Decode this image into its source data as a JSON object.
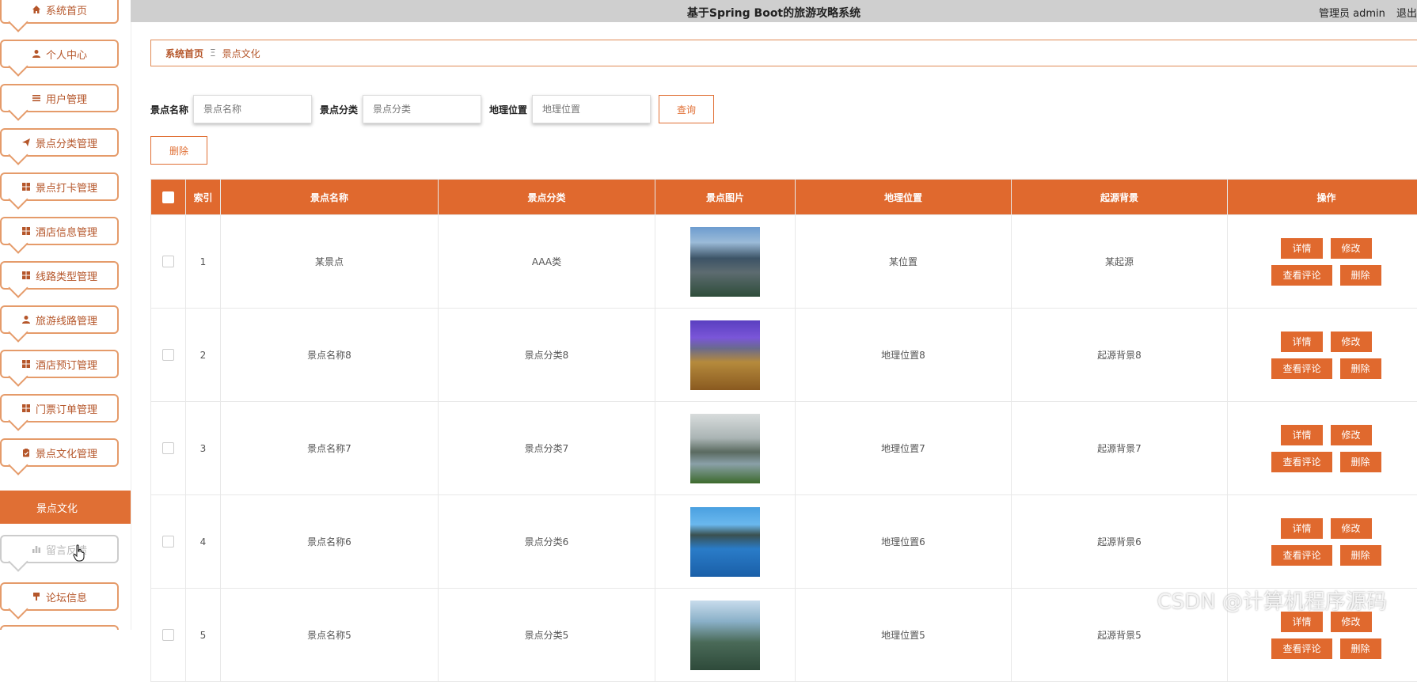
{
  "header": {
    "title": "基于Spring Boot的旅游攻略系统",
    "user": "管理员 admin",
    "logout": "退出"
  },
  "sidebar": {
    "items": [
      {
        "label": "系统首页",
        "icon": "home-icon"
      },
      {
        "label": "个人中心",
        "icon": "user-icon"
      },
      {
        "label": "用户管理",
        "icon": "list-icon"
      },
      {
        "label": "景点分类管理",
        "icon": "send-icon"
      },
      {
        "label": "景点打卡管理",
        "icon": "grid-icon"
      },
      {
        "label": "酒店信息管理",
        "icon": "grid-icon"
      },
      {
        "label": "线路类型管理",
        "icon": "grid-icon"
      },
      {
        "label": "旅游线路管理",
        "icon": "user-icon"
      },
      {
        "label": "酒店预订管理",
        "icon": "grid-icon"
      },
      {
        "label": "门票订单管理",
        "icon": "grid-icon"
      },
      {
        "label": "景点文化管理",
        "icon": "clipboard-icon"
      },
      {
        "label": "留言反馈",
        "icon": "bar-chart-icon"
      },
      {
        "label": "论坛信息",
        "icon": "pin-icon"
      }
    ],
    "active_sub": "景点文化"
  },
  "breadcrumb": {
    "home": "系统首页",
    "current": "景点文化"
  },
  "search": {
    "name_label": "景点名称",
    "name_placeholder": "景点名称",
    "category_label": "景点分类",
    "category_placeholder": "景点分类",
    "location_label": "地理位置",
    "location_placeholder": "地理位置",
    "query_button": "查询"
  },
  "delete_button": "删除",
  "table": {
    "headers": [
      "索引",
      "景点名称",
      "景点分类",
      "景点图片",
      "地理位置",
      "起源背景",
      "操作"
    ],
    "rows": [
      {
        "index": "1",
        "name": "某景点",
        "category": "AAA类",
        "location": "某位置",
        "origin": "某起源"
      },
      {
        "index": "2",
        "name": "景点名称8",
        "category": "景点分类8",
        "location": "地理位置8",
        "origin": "起源背景8"
      },
      {
        "index": "3",
        "name": "景点名称7",
        "category": "景点分类7",
        "location": "地理位置7",
        "origin": "起源背景7"
      },
      {
        "index": "4",
        "name": "景点名称6",
        "category": "景点分类6",
        "location": "地理位置6",
        "origin": "起源背景6"
      },
      {
        "index": "5",
        "name": "景点名称5",
        "category": "景点分类5",
        "location": "地理位置5",
        "origin": "起源背景5"
      }
    ],
    "actions": {
      "detail": "详情",
      "edit": "修改",
      "comments": "查看评论",
      "delete": "删除"
    }
  },
  "watermark": "CSDN @计算机程序源码",
  "colors": {
    "accent": "#e0692e",
    "accent_dark": "#b5562a",
    "border": "#e59b6a"
  }
}
